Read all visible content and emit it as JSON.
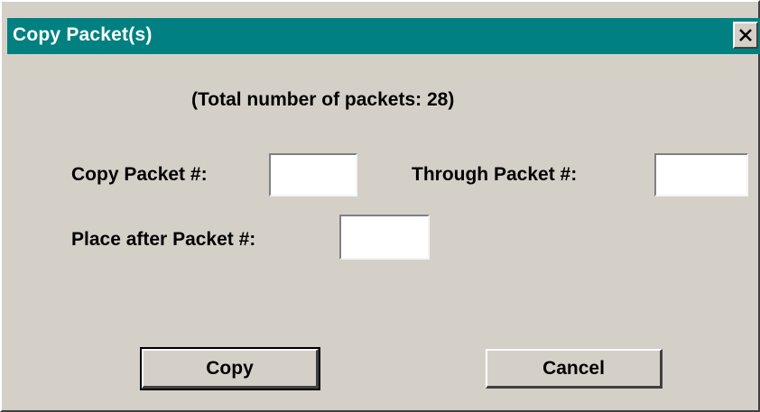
{
  "window": {
    "title": "Copy Packet(s)",
    "close_glyph": "X",
    "titlebar_color": "#008080",
    "background_color": "#d4d0c8"
  },
  "info": {
    "total_text": "(Total number of packets: 28)"
  },
  "fields": {
    "copy_packet": {
      "label": "Copy Packet #:",
      "value": "",
      "placeholder": ""
    },
    "through_packet": {
      "label": "Through Packet #:",
      "value": "",
      "placeholder": ""
    },
    "place_after": {
      "label": "Place after Packet #:",
      "value": "",
      "placeholder": ""
    }
  },
  "buttons": {
    "copy": "Copy",
    "cancel": "Cancel"
  }
}
